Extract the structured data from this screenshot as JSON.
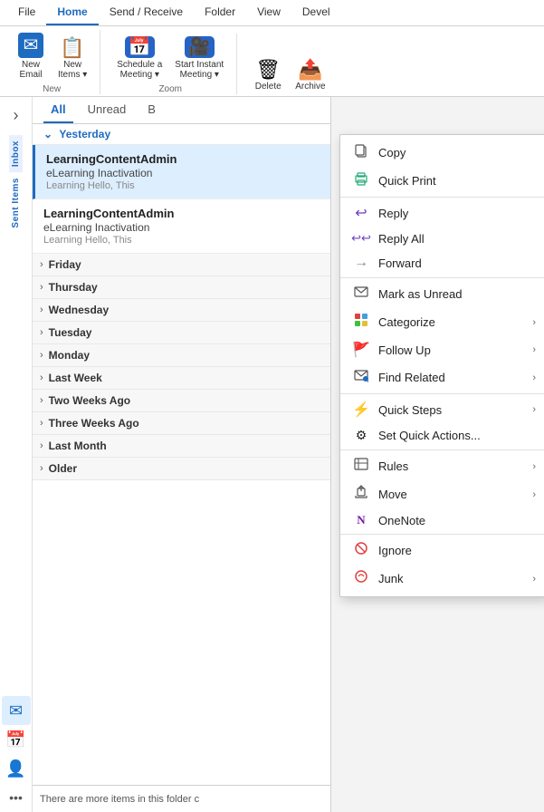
{
  "ribbon": {
    "tabs": [
      {
        "label": "File",
        "active": false
      },
      {
        "label": "Home",
        "active": true
      },
      {
        "label": "Send / Receive",
        "active": false
      },
      {
        "label": "Folder",
        "active": false
      },
      {
        "label": "View",
        "active": false
      },
      {
        "label": "Devel",
        "active": false
      }
    ],
    "buttons": [
      {
        "label": "New\nEmail",
        "icon": "✉",
        "type": "blue"
      },
      {
        "label": "New\nItems",
        "icon": "📋",
        "type": "dropdown"
      },
      {
        "label": "Schedule a\nMeeting",
        "icon": "📅",
        "type": "zoom"
      },
      {
        "label": "Start Instant\nMeeting",
        "icon": "🎥",
        "type": "zoom"
      },
      {
        "label": "Delete",
        "icon": "🗑",
        "type": "normal"
      },
      {
        "label": "Archive",
        "icon": "📥",
        "type": "normal"
      }
    ],
    "group_new_label": "New",
    "group_zoom_label": "Zoom"
  },
  "sidebar": {
    "tabs": [
      "All",
      "Unread",
      "B"
    ],
    "active_tab": "All",
    "yesterday_label": "Yesterday",
    "emails": [
      {
        "sender": "LearningContentAdmin",
        "subject": "eLearning Inactivation",
        "preview": "Learning  Hello, This",
        "selected": true
      },
      {
        "sender": "LearningContentAdmin",
        "subject": "eLearning Inactivation",
        "preview": "Learning  Hello, This",
        "selected": false
      }
    ],
    "day_groups": [
      {
        "label": "Friday"
      },
      {
        "label": "Thursday"
      },
      {
        "label": "Wednesday"
      },
      {
        "label": "Tuesday"
      },
      {
        "label": "Monday"
      },
      {
        "label": "Last Week"
      },
      {
        "label": "Two Weeks Ago"
      },
      {
        "label": "Three Weeks Ago"
      },
      {
        "label": "Last Month"
      },
      {
        "label": "Older"
      }
    ],
    "bottom_bar": "There are more items in this folder c"
  },
  "folder_labels": [
    {
      "label": "Inbox"
    },
    {
      "label": "Sent Items"
    }
  ],
  "context_menu": {
    "items": [
      {
        "icon": "📋",
        "label": "Copy",
        "has_arrow": false
      },
      {
        "icon": "🖨",
        "label": "Quick Print",
        "has_arrow": false
      },
      {
        "icon": "↩",
        "label": "Reply",
        "has_arrow": false
      },
      {
        "icon": "↩↩",
        "label": "Reply All",
        "has_arrow": false
      },
      {
        "icon": "→",
        "label": "Forward",
        "has_arrow": false
      },
      {
        "icon": "✉",
        "label": "Mark as Unread",
        "has_arrow": false
      },
      {
        "icon": "🏷",
        "label": "Categorize",
        "has_arrow": true
      },
      {
        "icon": "🚩",
        "label": "Follow Up",
        "has_arrow": true
      },
      {
        "icon": "🔍",
        "label": "Find Related",
        "has_arrow": true
      },
      {
        "icon": "⚡",
        "label": "Quick Steps",
        "has_arrow": true
      },
      {
        "icon": "⚙",
        "label": "Set Quick Actions...",
        "has_arrow": false
      },
      {
        "icon": "📜",
        "label": "Rules",
        "has_arrow": true
      },
      {
        "icon": "📂",
        "label": "Move",
        "has_arrow": true
      },
      {
        "icon": "N",
        "label": "OneNote",
        "has_arrow": false
      },
      {
        "icon": "🚫",
        "label": "Ignore",
        "has_arrow": false
      },
      {
        "icon": "🚫",
        "label": "Junk",
        "has_arrow": true
      }
    ]
  },
  "nav": {
    "icons": [
      {
        "icon": "✉",
        "label": "Mail",
        "active": false
      },
      {
        "icon": "📅",
        "label": "Calendar",
        "active": false
      },
      {
        "icon": "👤",
        "label": "People",
        "active": false
      },
      {
        "icon": "…",
        "label": "More",
        "active": false
      }
    ]
  }
}
